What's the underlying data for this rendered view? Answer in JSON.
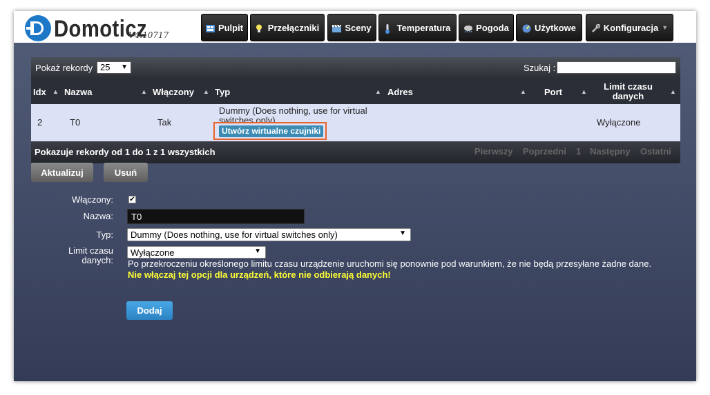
{
  "brand": {
    "name": "Domoticz",
    "version": "V4.10717"
  },
  "nav": [
    {
      "label": "Pulpit",
      "icon": "dashboard-icon"
    },
    {
      "label": "Przełączniki",
      "icon": "lightbulb-icon"
    },
    {
      "label": "Sceny",
      "icon": "clapper-icon"
    },
    {
      "label": "Temperatura",
      "icon": "thermometer-icon"
    },
    {
      "label": "Pogoda",
      "icon": "cloud-icon"
    },
    {
      "label": "Użytkowe",
      "icon": "gauge-icon"
    },
    {
      "label": "Konfiguracja",
      "icon": "wrench-icon"
    }
  ],
  "table": {
    "show_records_label": "Pokaż rekordy",
    "show_records_value": "25",
    "search_label": "Szukaj :",
    "search_value": "",
    "columns": [
      "Idx",
      "Nazwa",
      "Włączony",
      "Typ",
      "Adres",
      "Port",
      "Limit czasu danych"
    ],
    "row": {
      "idx": "2",
      "name": "T0",
      "enabled": "Tak",
      "type": "Dummy (Does nothing, use for virtual switches only)",
      "create_sensors_label": "Utwórz wirtualne czujniki",
      "address": "",
      "port": "",
      "limit": "Wyłączone"
    },
    "footer_info": "Pokazuje rekordy od 1 do 1 z 1 wszystkich",
    "pagination": {
      "first": "Pierwszy",
      "prev": "Poprzedni",
      "page": "1",
      "next": "Następny",
      "last": "Ostatni"
    }
  },
  "actions": {
    "update": "Aktualizuj",
    "delete": "Usuń"
  },
  "form": {
    "enabled_label": "Włączony:",
    "enabled_checked": true,
    "name_label": "Nazwa:",
    "name_value": "T0",
    "type_label": "Typ:",
    "type_value": "Dummy (Does nothing, use for virtual switches only)",
    "limit_label": "Limit czasu danych:",
    "limit_value": "Wyłączone",
    "limit_help": "Po przekroczeniu określonego limitu czasu urządzenie uruchomi się ponownie pod warunkiem, że nie będą przesyłane żadne dane.",
    "limit_warning": "Nie włączaj tej opcji dla urządzeń, które nie odbierają danych!",
    "add_label": "Dodaj"
  },
  "colors": {
    "highlight": "#e8632a",
    "warning": "#ffff33",
    "primary_button": "#3a9ad9",
    "row_bg": "#dde1f5"
  }
}
